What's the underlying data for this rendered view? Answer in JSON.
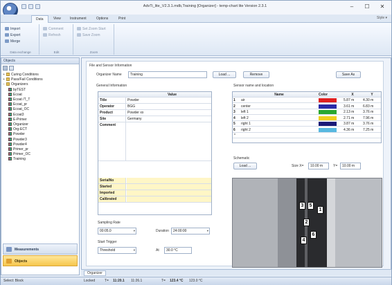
{
  "window": {
    "title": "AdvTi_lite_V2.3.1.mdb,Training [Organizer] - temp-chart lite Version 2.3.1",
    "controls": {
      "minimize": "–",
      "maximize": "☐",
      "close": "✕"
    }
  },
  "ribbon": {
    "tabs": [
      "Data",
      "View",
      "Instrument",
      "Options",
      "Print"
    ],
    "active_tab": "Data",
    "style_menu": "Style ▾",
    "groups": [
      {
        "label": "Data exchange",
        "buttons": [
          "Import",
          "Export",
          "Merge"
        ]
      },
      {
        "label": "Edit",
        "buttons": [
          "Comment",
          "Refresh"
        ]
      },
      {
        "label": "Zoom",
        "buttons": [
          "Set Zoom Start",
          "Save Zoom"
        ]
      }
    ]
  },
  "sidebar": {
    "header": "Objects",
    "tree": [
      {
        "label": "Curing Conditions",
        "level": 0,
        "kind": "folder",
        "expander": "+"
      },
      {
        "label": "Pass/Fail Conditions",
        "level": 0,
        "kind": "folder",
        "expander": "+"
      },
      {
        "label": "Organizers",
        "level": 0,
        "kind": "folder",
        "expander": "−"
      },
      {
        "label": "byTEST",
        "level": 1,
        "kind": "sheet"
      },
      {
        "label": "Ecoat",
        "level": 1,
        "kind": "sheet"
      },
      {
        "label": "Ecoat /T_T",
        "level": 1,
        "kind": "sheet"
      },
      {
        "label": "Ecoat_pr",
        "level": 1,
        "kind": "sheet"
      },
      {
        "label": "Ecoat_OC",
        "level": 1,
        "kind": "sheet"
      },
      {
        "label": "Ecoat3",
        "level": 1,
        "kind": "sheet"
      },
      {
        "label": "E-Primer",
        "level": 1,
        "kind": "sheet"
      },
      {
        "label": "Organizer",
        "level": 1,
        "kind": "sheet"
      },
      {
        "label": "Org-ECT",
        "level": 1,
        "kind": "sheet"
      },
      {
        "label": "Powder",
        "level": 1,
        "kind": "sheet"
      },
      {
        "label": "Powder3",
        "level": 1,
        "kind": "sheet"
      },
      {
        "label": "Powder4",
        "level": 1,
        "kind": "sheet"
      },
      {
        "label": "Primer_pr",
        "level": 1,
        "kind": "sheet"
      },
      {
        "label": "Primer_OC",
        "level": 1,
        "kind": "sheet"
      },
      {
        "label": "Training",
        "level": 1,
        "kind": "sheet"
      }
    ],
    "nav": {
      "measurements": "Measurements",
      "objects": "Objects"
    }
  },
  "main": {
    "file_section": "File and Sensor Information",
    "organizer_name_label": "Organizer Name",
    "organizer_name_value": "Training",
    "load_label": "Load ...",
    "remove_label": "Remove",
    "save_as_label": "Save As",
    "general_info_title": "General Information",
    "general_info": {
      "value_header": "Value",
      "rows": [
        {
          "key": "Title",
          "value": "Powder"
        },
        {
          "key": "Operator",
          "value": "BGG"
        },
        {
          "key": "Product",
          "value": "Powder xx"
        },
        {
          "key": "Site",
          "value": "Germany"
        },
        {
          "key": "Comment",
          "value": ""
        }
      ],
      "yellow_rows": [
        {
          "key": "SerialNo"
        },
        {
          "key": "Started"
        },
        {
          "key": "Imported"
        },
        {
          "key": "Calibrated"
        }
      ]
    },
    "sensor_section_title": "Sensor name and location",
    "sensor_table": {
      "headers": {
        "name": "Name",
        "color": "Color",
        "x": "X",
        "y": "Y"
      },
      "rows": [
        {
          "no": "1",
          "name": "air",
          "color": "#e02020",
          "x": "5.87 m",
          "y": "4.30 m"
        },
        {
          "no": "2",
          "name": "center",
          "color": "#2a2aa8",
          "x": "3.61 m",
          "y": "6.83 m"
        },
        {
          "no": "3",
          "name": "left 1",
          "color": "#2aa830",
          "x": "2.13 m",
          "y": "3.76 m"
        },
        {
          "no": "4",
          "name": "left 2",
          "color": "#f0d020",
          "x": "2.71 m",
          "y": "7.96 m"
        },
        {
          "no": "5",
          "name": "right 1",
          "color": "#1a1a78",
          "x": "3.87 m",
          "y": "3.76 m"
        },
        {
          "no": "6",
          "name": "right 2",
          "color": "#58b8e0",
          "x": "4.36 m",
          "y": "7.25 m"
        }
      ],
      "new_row_marker": "*"
    },
    "schematic": {
      "title": "Schematic",
      "load_label": "Load ...",
      "size_x_label": "Size X=",
      "size_x_value": "10.00 m",
      "size_y_label": "Y=",
      "size_y_value": "10.00 m",
      "markers": [
        "3",
        "5",
        "1",
        "2",
        "4",
        "6"
      ]
    },
    "sampling": {
      "title": "Sampling Rate",
      "rate_value": "00:05.0",
      "duration_label": "Duration",
      "duration_value": "24:00:00"
    },
    "start_trigger": {
      "title": "Start Trigger",
      "mode_value": "Threshold",
      "at_label": "At",
      "threshold_value": "30.0 °C"
    }
  },
  "doc_tab": "Organizer",
  "status": {
    "mode": "Select: Block",
    "locked": "Locked",
    "t1_label": "T=",
    "t1_value": "11:20.1",
    "t1_time": "11:26.1",
    "t2_label": "T=",
    "t2_value": "123.4 °C",
    "t2_time": "123.0 °C"
  }
}
